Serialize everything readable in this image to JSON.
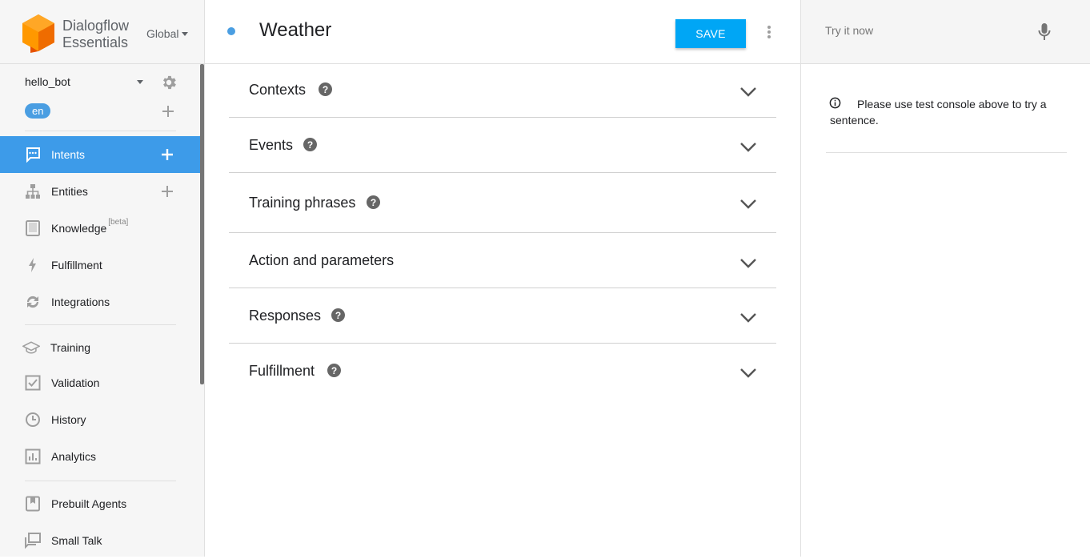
{
  "brand": {
    "name_line1": "Dialogflow",
    "name_line2": "Essentials",
    "region": "Global"
  },
  "agent": {
    "name": "hello_bot",
    "language": "en"
  },
  "sidebar": {
    "items": [
      {
        "label": "Intents",
        "icon": "chat-bubble-icon",
        "active": true,
        "has_add": true
      },
      {
        "label": "Entities",
        "icon": "hierarchy-icon",
        "active": false,
        "has_add": true
      },
      {
        "label": "Knowledge",
        "badge": "[beta]",
        "icon": "book-icon",
        "active": false,
        "has_add": false
      },
      {
        "label": "Fulfillment",
        "icon": "bolt-icon",
        "active": false,
        "has_add": false
      },
      {
        "label": "Integrations",
        "icon": "sync-icon",
        "active": false,
        "has_add": false
      },
      {
        "label": "Training",
        "icon": "school-icon",
        "active": false,
        "has_add": false
      },
      {
        "label": "Validation",
        "icon": "check-box-icon",
        "active": false,
        "has_add": false
      },
      {
        "label": "History",
        "icon": "clock-icon",
        "active": false,
        "has_add": false
      },
      {
        "label": "Analytics",
        "icon": "bar-chart-icon",
        "active": false,
        "has_add": false
      },
      {
        "label": "Prebuilt Agents",
        "icon": "bookmark-icon",
        "active": false,
        "has_add": false
      },
      {
        "label": "Small Talk",
        "icon": "chat-copy-icon",
        "active": false,
        "has_add": false
      }
    ]
  },
  "intent": {
    "title": "Weather",
    "save_label": "SAVE"
  },
  "sections": [
    {
      "title": "Contexts",
      "help": true
    },
    {
      "title": "Events",
      "help": true
    },
    {
      "title": "Training phrases",
      "help": true
    },
    {
      "title": "Action and parameters",
      "help": false
    },
    {
      "title": "Responses",
      "help": true
    },
    {
      "title": "Fulfillment",
      "help": true
    }
  ],
  "test_console": {
    "placeholder": "Try it now",
    "info_text": "Please use test console above to try a sentence."
  },
  "colors": {
    "accent": "#3d9be9",
    "save_button": "#00a6f5",
    "logo": "#ef6c00"
  }
}
